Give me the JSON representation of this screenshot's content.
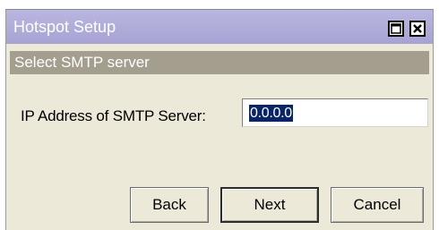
{
  "window": {
    "title": "Hotspot Setup"
  },
  "titlebar_buttons": [
    {
      "icon": "maximize-icon"
    },
    {
      "icon": "close-icon"
    }
  ],
  "section": {
    "title": "Select SMTP server"
  },
  "form": {
    "ip_label": "IP Address of SMTP Server:",
    "ip_value": "0.0.0.0"
  },
  "buttons": {
    "back": "Back",
    "next": "Next",
    "cancel": "Cancel"
  },
  "colors": {
    "titlebar": "#a6a3d4",
    "section_bar": "#a39e8d",
    "selection": "#0a246a",
    "dialog_bg": "#ece9d8"
  }
}
